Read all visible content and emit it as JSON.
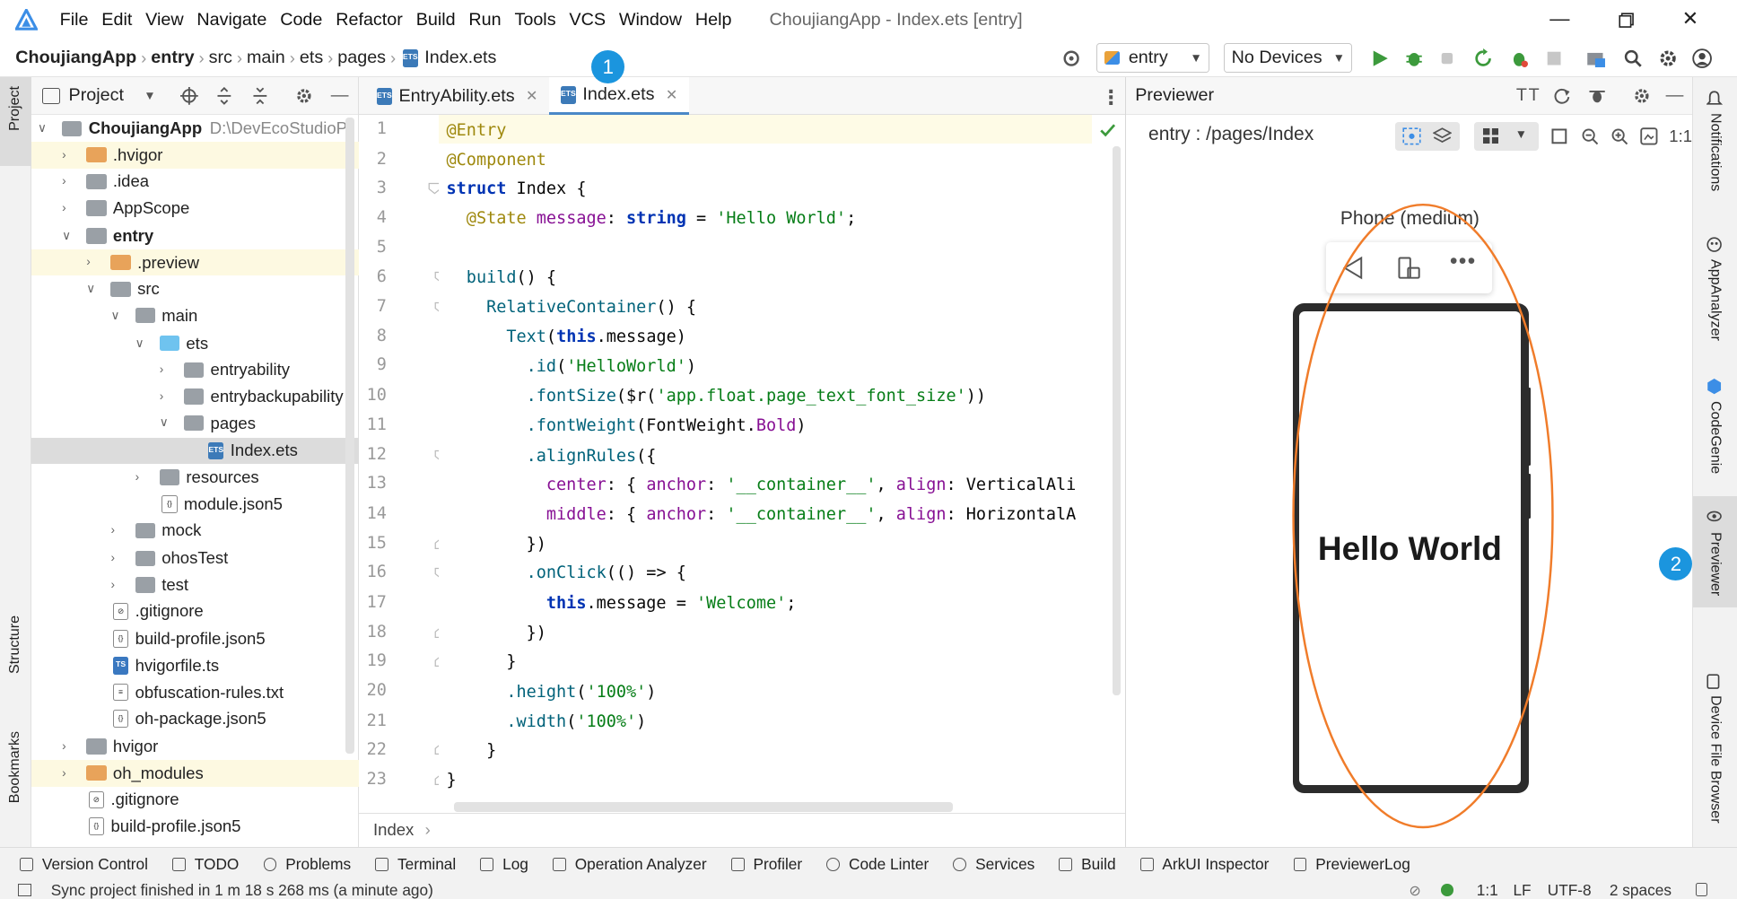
{
  "window": {
    "title": "ChoujiangApp - Index.ets [entry]"
  },
  "menu": [
    "File",
    "Edit",
    "View",
    "Navigate",
    "Code",
    "Refactor",
    "Build",
    "Run",
    "Tools",
    "VCS",
    "Window",
    "Help"
  ],
  "breadcrumb": [
    "ChoujiangApp",
    "entry",
    "src",
    "main",
    "ets",
    "pages",
    "Index.ets"
  ],
  "run_config": {
    "module": "entry",
    "device": "No Devices"
  },
  "project_panel": {
    "title": "Project",
    "root_name": "ChoujiangApp",
    "root_path": "D:\\DevEcoStudioPr",
    "items": [
      {
        "label": ".hvigor"
      },
      {
        "label": ".idea"
      },
      {
        "label": "AppScope"
      },
      {
        "label": "entry"
      },
      {
        "label": ".preview"
      },
      {
        "label": "src"
      },
      {
        "label": "main"
      },
      {
        "label": "ets"
      },
      {
        "label": "entryability"
      },
      {
        "label": "entrybackupability"
      },
      {
        "label": "pages"
      },
      {
        "label": "Index.ets"
      },
      {
        "label": "resources"
      },
      {
        "label": "module.json5"
      },
      {
        "label": "mock"
      },
      {
        "label": "ohosTest"
      },
      {
        "label": "test"
      },
      {
        "label": ".gitignore"
      },
      {
        "label": "build-profile.json5"
      },
      {
        "label": "hvigorfile.ts"
      },
      {
        "label": "obfuscation-rules.txt"
      },
      {
        "label": "oh-package.json5"
      },
      {
        "label": "hvigor"
      },
      {
        "label": "oh_modules"
      },
      {
        "label": ".gitignore"
      },
      {
        "label": "build-profile.json5"
      }
    ]
  },
  "editor": {
    "tabs": [
      {
        "label": "EntryAbility.ets"
      },
      {
        "label": "Index.ets"
      }
    ],
    "line_numbers": [
      "1",
      "2",
      "3",
      "4",
      "5",
      "6",
      "7",
      "8",
      "9",
      "10",
      "11",
      "12",
      "13",
      "14",
      "15",
      "16",
      "17",
      "18",
      "19",
      "20",
      "21",
      "22",
      "23"
    ],
    "code": {
      "l1": "@Entry",
      "l2": "@Component",
      "l3a": "struct",
      "l3b": " Index {",
      "l4a": "  @State",
      "l4b": " message",
      "l4c": ": ",
      "l4d": "string",
      "l4e": " = ",
      "l4f": "'Hello World'",
      "l4g": ";",
      "l6a": "  build",
      "l6b": "() {",
      "l7a": "    RelativeContainer",
      "l7b": "() {",
      "l8a": "      Text",
      "l8b": "(",
      "l8c": "this",
      "l8d": ".message)",
      "l9a": "        .id",
      "l9b": "(",
      "l9c": "'HelloWorld'",
      "l9d": ")",
      "l10a": "        .fontSize",
      "l10b": "($r(",
      "l10c": "'app.float.page_text_font_size'",
      "l10d": "))",
      "l11a": "        .fontWeight",
      "l11b": "(FontWeight.",
      "l11c": "Bold",
      "l11d": ")",
      "l12a": "        .alignRules",
      "l12b": "({",
      "l13a": "          center",
      "l13b": ": { ",
      "l13c": "anchor",
      "l13d": ": ",
      "l13e": "'__container__'",
      "l13f": ", ",
      "l13g": "align",
      "l13h": ": VerticalAli",
      "l14a": "          middle",
      "l14b": ": { ",
      "l14c": "anchor",
      "l14d": ": ",
      "l14e": "'__container__'",
      "l14f": ", ",
      "l14g": "align",
      "l14h": ": HorizontalA",
      "l15": "        })",
      "l16a": "        .onClick",
      "l16b": "(() => {",
      "l17a": "          this",
      "l17b": ".message = ",
      "l17c": "'Welcome'",
      "l17d": ";",
      "l18": "        })",
      "l19": "      }",
      "l20a": "      .height",
      "l20b": "(",
      "l20c": "'100%'",
      "l20d": ")",
      "l21a": "      .width",
      "l21b": "(",
      "l21c": "'100%'",
      "l21d": ")",
      "l22": "    }",
      "l23": "}"
    },
    "footer_crumb": "Index",
    "badge": "1"
  },
  "previewer": {
    "title": "Previewer",
    "route": "entry : /pages/Index",
    "zoom_label": "1:1",
    "device_name": "Phone (medium)",
    "screen_text": "Hello World",
    "badge": "2"
  },
  "right_tabs": [
    "Notifications",
    "AppAnalyzer",
    "CodeGenie",
    "Previewer",
    "Device File Browser"
  ],
  "left_tabs": [
    "Project",
    "Structure",
    "Bookmarks"
  ],
  "bottom_tools": [
    "Version Control",
    "TODO",
    "Problems",
    "Terminal",
    "Log",
    "Operation Analyzer",
    "Profiler",
    "Code Linter",
    "Services",
    "Build",
    "ArkUI Inspector",
    "PreviewerLog"
  ],
  "status": {
    "message": "Sync project finished in 1 m 18 s 268 ms (a minute ago)",
    "position": "1:1",
    "line_sep": "LF",
    "encoding": "UTF-8",
    "indent": "2 spaces"
  },
  "colors": {
    "accent": "#1b95de",
    "annotation": "#f07c2a",
    "run_green": "#3c9a3c"
  }
}
